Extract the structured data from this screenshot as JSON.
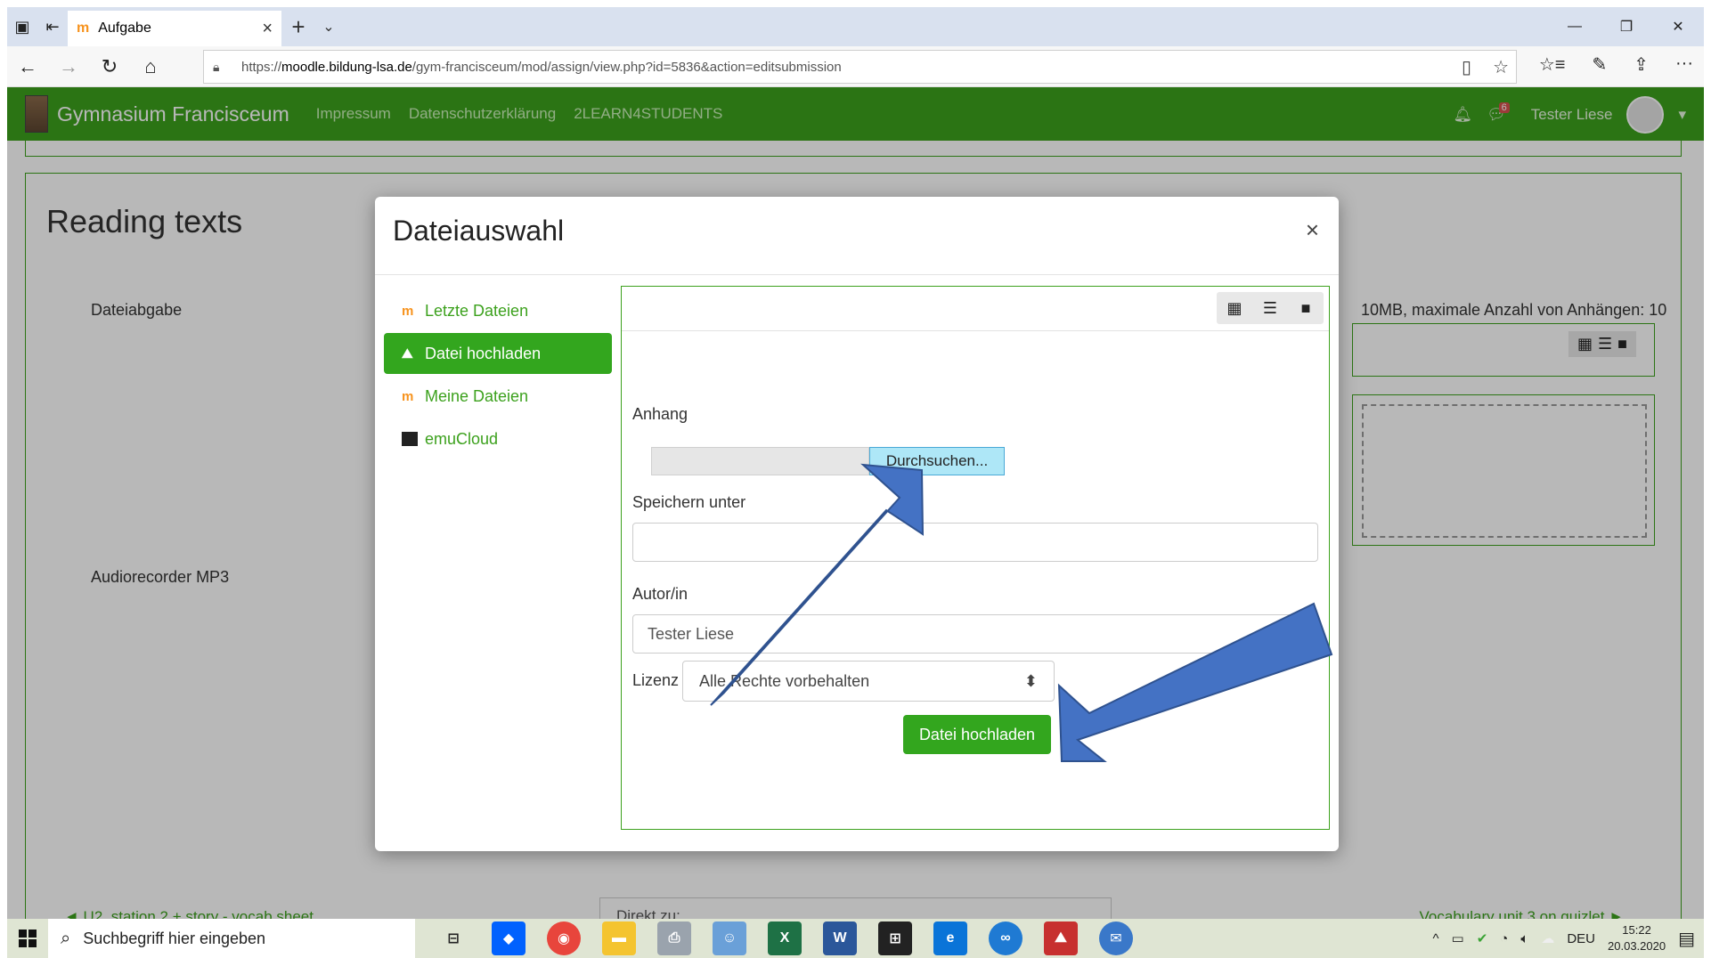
{
  "browser": {
    "tab_title": "Aufgabe",
    "tab_favicon": "moodle-icon",
    "url_prefix": "https://",
    "url_host": "moodle.bildung-lsa.de",
    "url_path": "/gym-francisceum/mod/assign/view.php?id=5836&action=editsubmission"
  },
  "site": {
    "name": "Gymnasium Francisceum",
    "nav_links": [
      "Impressum",
      "Datenschutzerklärung",
      "2LEARN4STUDENTS"
    ],
    "user_name": "Tester Liese",
    "message_count": "6",
    "accent_color": "#3ca11d"
  },
  "page": {
    "heading": "Reading texts",
    "label_submission": "Dateiabgabe",
    "label_audio": "Audiorecorder MP3",
    "max_info": "10MB, maximale Anzahl von Anhängen: 10",
    "footer_prev": "◄ U2, station 2 + story - vocab sheet",
    "footer_jump": "Direkt zu:",
    "footer_next": "Vocabulary unit 3 on quizlet ►"
  },
  "modal": {
    "title": "Dateiauswahl",
    "close": "×",
    "repositories": [
      {
        "label": "Letzte Dateien",
        "icon": "moodle-icon",
        "active": false
      },
      {
        "label": "Datei hochladen",
        "icon": "upload-icon",
        "active": true
      },
      {
        "label": "Meine Dateien",
        "icon": "moodle-icon",
        "active": false
      },
      {
        "label": "emuCloud",
        "icon": "cloud-icon",
        "active": false
      }
    ],
    "form": {
      "attachment_label": "Anhang",
      "browse_button": "Durchsuchen...",
      "save_as_label": "Speichern unter",
      "save_as_value": "",
      "author_label": "Autor/in",
      "author_value": "Tester Liese",
      "license_label": "Lizenz",
      "license_value": "Alle Rechte vorbehalten",
      "upload_button": "Datei hochladen"
    }
  },
  "taskbar": {
    "search_placeholder": "Suchbegriff hier eingeben",
    "language": "DEU",
    "time": "15:22",
    "date": "20.03.2020"
  },
  "annotation": {
    "arrow_color": "#4472c4"
  }
}
